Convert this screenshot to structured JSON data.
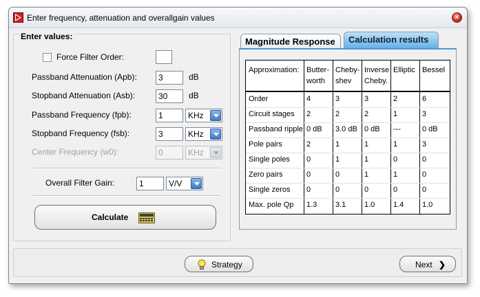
{
  "window": {
    "title": "Enter frequency, attenuation and overallgain values"
  },
  "enter_values": {
    "group_title": "Enter values:",
    "force_filter_order": {
      "label": "Force Filter Order:",
      "checked": false,
      "value": ""
    },
    "passband_attenuation": {
      "label": "Passband Attenuation  (Apb):",
      "value": "3",
      "unit": "dB"
    },
    "stopband_attenuation": {
      "label": "Stopband Attenuation (Asb):",
      "value": "30",
      "unit": "dB"
    },
    "passband_frequency": {
      "label": "Passband Frequency (fpb):",
      "value": "1",
      "unit": "KHz"
    },
    "stopband_frequency": {
      "label": "Stopband Frequency (fsb):",
      "value": "3",
      "unit": "KHz"
    },
    "center_frequency": {
      "label": "Center Frequency (w0):",
      "value": "0",
      "unit": "KHz",
      "disabled": true
    },
    "overall_gain": {
      "label": "Overall Filter Gain:",
      "value": "1",
      "unit": "V/V"
    },
    "calculate_label": "Calculate"
  },
  "tabs": [
    {
      "label": "Magnitude Response",
      "active": false
    },
    {
      "label": "Calculation results",
      "active": true
    }
  ],
  "results": {
    "headers": [
      "Approximation:",
      "Butter-\nworth",
      "Cheby-\nshev",
      "Inverse\nCheby.",
      "Elliptic",
      "Bessel"
    ],
    "rows": [
      [
        "Order",
        "4",
        "3",
        "3",
        "2",
        "6"
      ],
      [
        "Circuit stages",
        "2",
        "2",
        "2",
        "1",
        "3"
      ],
      [
        "Passband ripple",
        "0 dB",
        "3.0 dB",
        "0 dB",
        "---",
        "0 dB"
      ],
      [
        "Pole pairs",
        "2",
        "1",
        "1",
        "1",
        "3"
      ],
      [
        "Single poles",
        "0",
        "1",
        "1",
        "0",
        "0"
      ],
      [
        "Zero pairs",
        "0",
        "0",
        "1",
        "1",
        "0"
      ],
      [
        "Single zeros",
        "0",
        "0",
        "0",
        "0",
        "0"
      ],
      [
        "Max. pole Qp",
        "1.3",
        "3.1",
        "1.0",
        "1.4",
        "1.0"
      ]
    ]
  },
  "footer": {
    "strategy_label": "Strategy",
    "next_label": "Next"
  },
  "colors": {
    "tab_active": "#63aee8",
    "dropdown": "#3e78c8",
    "close": "#d0281a"
  }
}
